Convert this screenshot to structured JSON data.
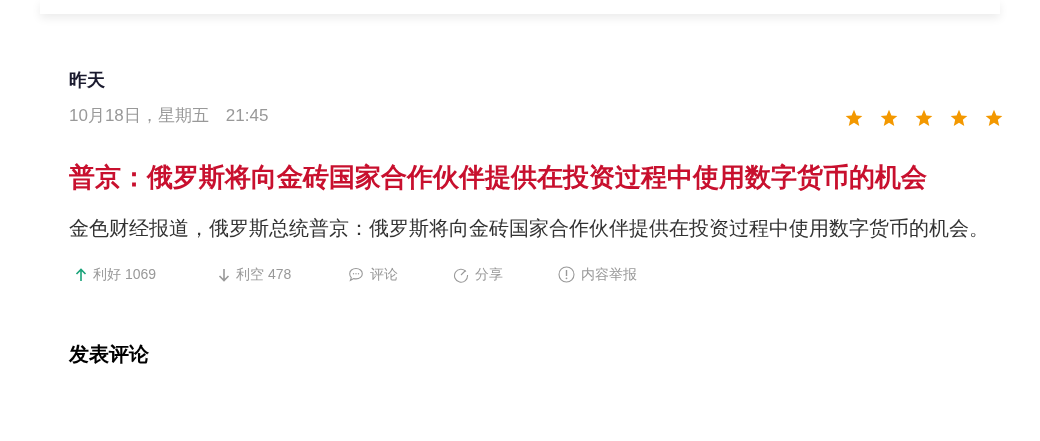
{
  "article": {
    "day": "昨天",
    "datetime": "10月18日，星期五　21:45",
    "stars": 5,
    "title": "普京：俄罗斯将向金砖国家合作伙伴提供在投资过程中使用数字货币的机会",
    "body": "金色财经报道，俄罗斯总统普京：俄罗斯将向金砖国家合作伙伴提供在投资过程中使用数字货币的机会。",
    "actions": [
      {
        "kind": "bullish",
        "label": "利好 1069"
      },
      {
        "kind": "bearish",
        "label": "利空 478"
      },
      {
        "kind": "comment",
        "label": "评论"
      },
      {
        "kind": "share",
        "label": "分享"
      },
      {
        "kind": "report",
        "label": "内容举报"
      }
    ]
  },
  "comment_section": {
    "heading": "发表评论"
  }
}
